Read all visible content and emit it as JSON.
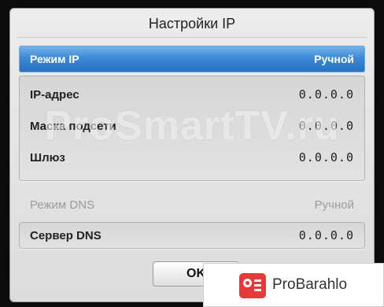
{
  "dialog": {
    "title": "Настройки IP",
    "ip_mode": {
      "label": "Режим IP",
      "value": "Ручной"
    },
    "ip_fields": [
      {
        "label": "IP-адрес",
        "value": "0.0.0.0"
      },
      {
        "label": "Маска подсети",
        "value": "0.0.0.0"
      },
      {
        "label": "Шлюз",
        "value": "0.0.0.0"
      }
    ],
    "dns_mode": {
      "label": "Режим DNS",
      "value": "Ручной"
    },
    "dns_server": {
      "label": "Сервер DNS",
      "value": "0.0.0.0"
    },
    "ok_label": "OK"
  },
  "watermark": "ProSmartTV.ru",
  "badge": {
    "text": "ProBarahlo",
    "icon": "radio-icon",
    "accent": "#e63a3a"
  },
  "colors": {
    "selected": "#3d8ad6",
    "dialog_bg": "#e4e4e4",
    "disabled_text": "#9c9c9c"
  }
}
